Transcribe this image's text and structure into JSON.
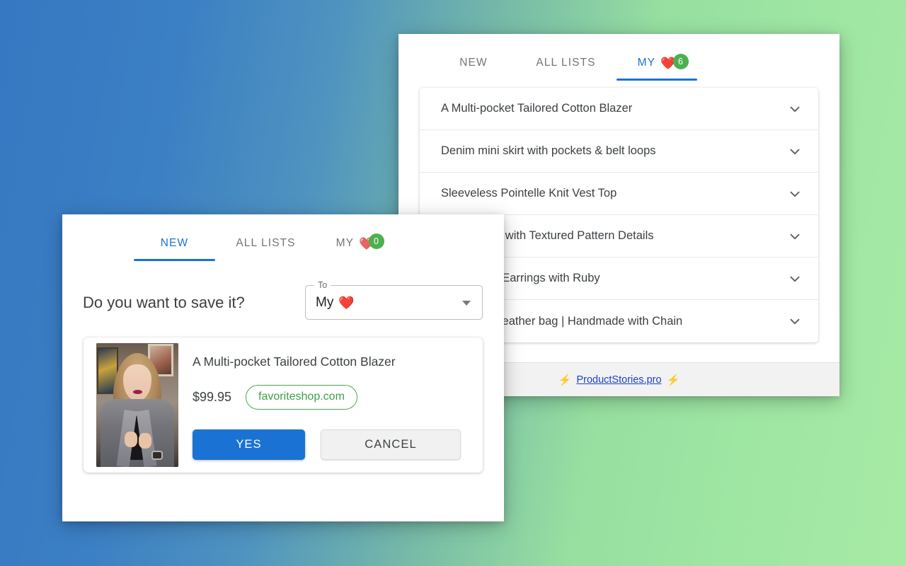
{
  "background": {
    "gradient_from": "#3678c2",
    "gradient_to": "#a7eaa6"
  },
  "theme": {
    "accent_blue": "#1a73d4",
    "badge_green": "#4caf50",
    "chip_green": "#3f9e48",
    "link_blue": "#1a3ecf"
  },
  "back_panel": {
    "tabs": [
      {
        "label": "NEW",
        "active": false
      },
      {
        "label": "ALL LISTS",
        "active": false
      },
      {
        "label": "MY",
        "active": true,
        "heart_icon": "heart-icon",
        "heart": "❤️",
        "badge": "6"
      }
    ],
    "list_items": [
      {
        "title": "A Multi-pocket Tailored Cotton Blazer",
        "chevron": "chevron-down-icon"
      },
      {
        "title": "Denim mini skirt with pockets & belt loops",
        "chevron": "chevron-down-icon"
      },
      {
        "title": "Sleeveless Pointelle Knit Vest Top",
        "chevron": "chevron-down-icon"
      },
      {
        "title": "Collar Scarf with Textured Pattern Details",
        "chevron": "chevron-down-icon"
      },
      {
        "title": "Drop Silver Earrings with Ruby",
        "chevron": "chevron-down-icon"
      },
      {
        "title": "Yellow eco leather bag | Handmade with Chain",
        "chevron": "chevron-down-icon"
      }
    ],
    "footer": {
      "bolt_left": "⚡",
      "link_text": "ProductStories.pro",
      "bolt_right": "⚡"
    }
  },
  "front_dialog": {
    "tabs": [
      {
        "label": "NEW",
        "active": true
      },
      {
        "label": "ALL LISTS",
        "active": false
      },
      {
        "label": "MY",
        "active": false,
        "heart_icon": "heart-icon",
        "heart": "❤️",
        "badge": "0"
      }
    ],
    "question": "Do you want to save it?",
    "select": {
      "float_label": "To",
      "value_text": "My",
      "value_heart": "❤️",
      "caret_icon": "caret-down-icon"
    },
    "product": {
      "thumbnail_alt": "Woman wearing a grey tailored cotton blazer",
      "title": "A Multi-pocket Tailored Cotton Blazer",
      "price": "$99.95",
      "domain": "favoriteshop.com"
    },
    "buttons": {
      "confirm_label": "YES",
      "cancel_label": "CANCEL"
    }
  }
}
